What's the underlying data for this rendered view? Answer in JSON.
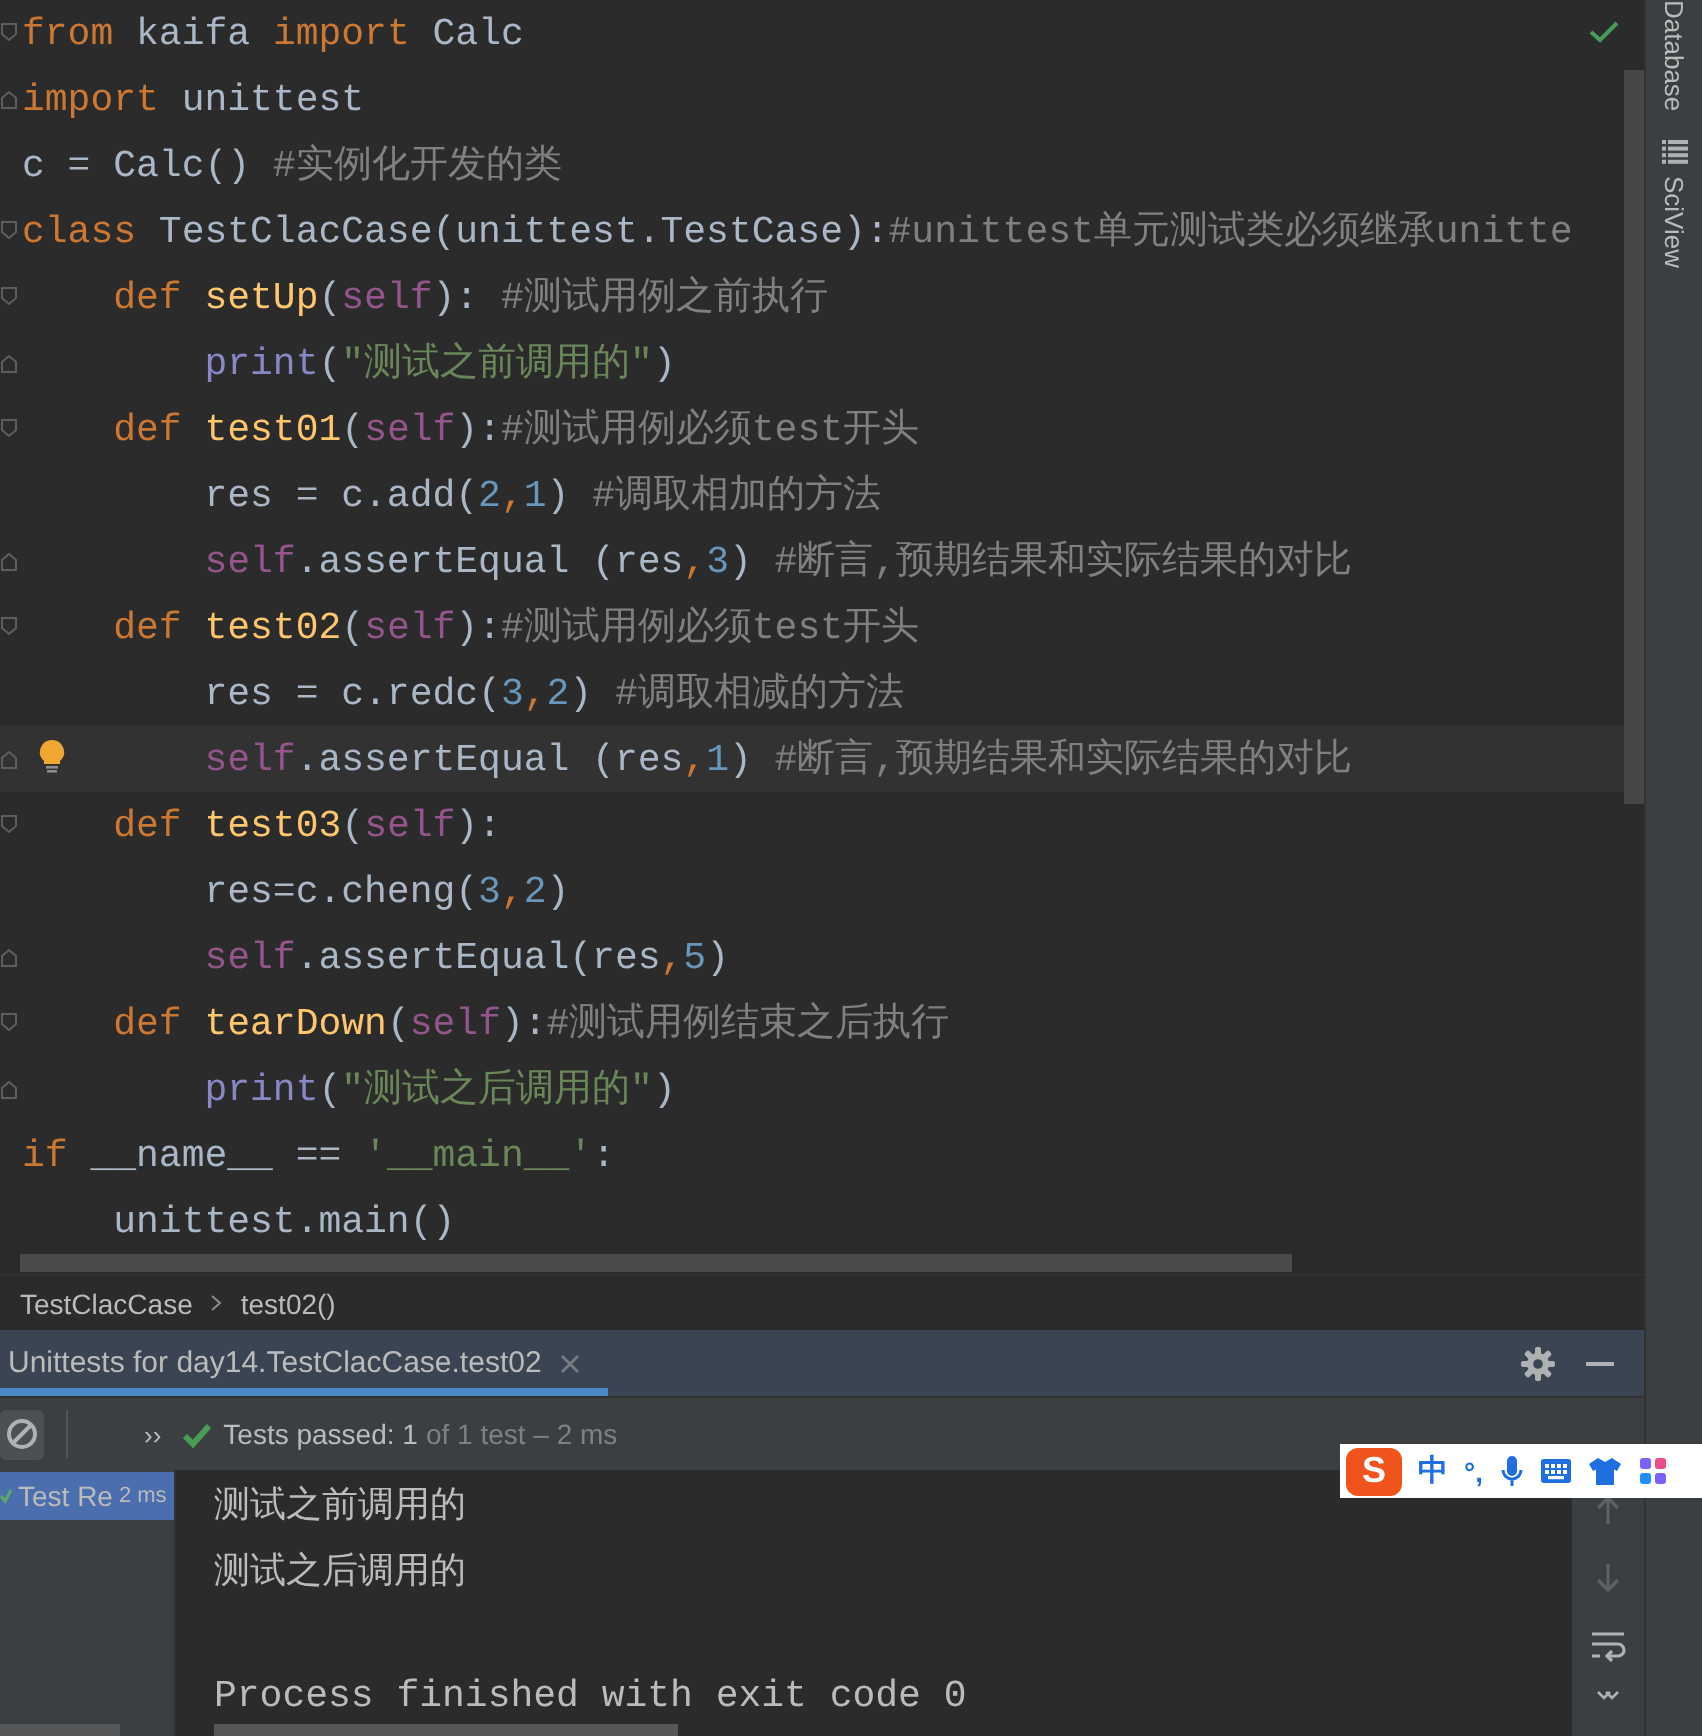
{
  "editor": {
    "inspection_ok": true,
    "lines": [
      {
        "current": false,
        "bulb": false,
        "fold_start": true,
        "fold_end": false,
        "tokens": [
          {
            "kind": "keyword",
            "text": "from"
          },
          {
            "kind": "plain",
            "text": " kaifa "
          },
          {
            "kind": "keyword",
            "text": "import"
          },
          {
            "kind": "plain",
            "text": " Calc"
          }
        ]
      },
      {
        "current": false,
        "bulb": false,
        "fold_start": false,
        "fold_end": true,
        "tokens": [
          {
            "kind": "keyword",
            "text": "import"
          },
          {
            "kind": "plain",
            "text": " unittest"
          }
        ]
      },
      {
        "current": false,
        "bulb": false,
        "fold_start": false,
        "fold_end": false,
        "tokens": [
          {
            "kind": "plain",
            "text": "c = Calc() "
          },
          {
            "kind": "comment",
            "text": "#实例化开发的类"
          }
        ]
      },
      {
        "current": false,
        "bulb": false,
        "fold_start": true,
        "fold_end": false,
        "tokens": [
          {
            "kind": "keyword",
            "text": "class"
          },
          {
            "kind": "plain",
            "text": " TestClacCase(unittest.TestCase):"
          },
          {
            "kind": "comment",
            "text": "#unittest单元测试类必须继承unitte"
          }
        ]
      },
      {
        "current": false,
        "bulb": false,
        "fold_start": true,
        "fold_end": false,
        "tokens": [
          {
            "kind": "keyword",
            "text": "    def"
          },
          {
            "kind": "function",
            "text": " setUp"
          },
          {
            "kind": "plain",
            "text": "("
          },
          {
            "kind": "self",
            "text": "self"
          },
          {
            "kind": "plain",
            "text": "): "
          },
          {
            "kind": "comment",
            "text": "#测试用例之前执行"
          }
        ]
      },
      {
        "current": false,
        "bulb": false,
        "fold_start": false,
        "fold_end": true,
        "tokens": [
          {
            "kind": "builtin",
            "text": "        print"
          },
          {
            "kind": "plain",
            "text": "("
          },
          {
            "kind": "string",
            "text": "\"测试之前调用的\""
          },
          {
            "kind": "plain",
            "text": ")"
          }
        ]
      },
      {
        "current": false,
        "bulb": false,
        "fold_start": true,
        "fold_end": false,
        "tokens": [
          {
            "kind": "keyword",
            "text": "    def"
          },
          {
            "kind": "function",
            "text": " test01"
          },
          {
            "kind": "plain",
            "text": "("
          },
          {
            "kind": "self",
            "text": "self"
          },
          {
            "kind": "plain",
            "text": "):"
          },
          {
            "kind": "comment",
            "text": "#测试用例必须test开头"
          }
        ]
      },
      {
        "current": false,
        "bulb": false,
        "fold_start": false,
        "fold_end": false,
        "tokens": [
          {
            "kind": "plain",
            "text": "        res = c.add("
          },
          {
            "kind": "number",
            "text": "2"
          },
          {
            "kind": "punct",
            "text": ","
          },
          {
            "kind": "number",
            "text": "1"
          },
          {
            "kind": "plain",
            "text": ") "
          },
          {
            "kind": "comment",
            "text": "#调取相加的方法"
          }
        ]
      },
      {
        "current": false,
        "bulb": false,
        "fold_start": false,
        "fold_end": true,
        "tokens": [
          {
            "kind": "self",
            "text": "        self"
          },
          {
            "kind": "plain",
            "text": ".assertEqual (res"
          },
          {
            "kind": "punct",
            "text": ","
          },
          {
            "kind": "number",
            "text": "3"
          },
          {
            "kind": "plain",
            "text": ") "
          },
          {
            "kind": "comment",
            "text": "#断言,预期结果和实际结果的对比"
          }
        ]
      },
      {
        "current": false,
        "bulb": false,
        "fold_start": true,
        "fold_end": false,
        "tokens": [
          {
            "kind": "keyword",
            "text": "    def"
          },
          {
            "kind": "function",
            "text": " test02"
          },
          {
            "kind": "plain",
            "text": "("
          },
          {
            "kind": "self",
            "text": "self"
          },
          {
            "kind": "plain",
            "text": "):"
          },
          {
            "kind": "comment",
            "text": "#测试用例必须test开头"
          }
        ]
      },
      {
        "current": false,
        "bulb": false,
        "fold_start": false,
        "fold_end": false,
        "tokens": [
          {
            "kind": "plain",
            "text": "        res = c.redc("
          },
          {
            "kind": "number",
            "text": "3"
          },
          {
            "kind": "punct",
            "text": ","
          },
          {
            "kind": "number",
            "text": "2"
          },
          {
            "kind": "plain",
            "text": ") "
          },
          {
            "kind": "comment",
            "text": "#调取相减的方法"
          }
        ]
      },
      {
        "current": true,
        "bulb": true,
        "fold_start": false,
        "fold_end": true,
        "tokens": [
          {
            "kind": "self",
            "text": "        self"
          },
          {
            "kind": "plain",
            "text": ".assertEqual (res"
          },
          {
            "kind": "punct",
            "text": ","
          },
          {
            "kind": "number",
            "text": "1"
          },
          {
            "kind": "plain",
            "text": ") "
          },
          {
            "kind": "comment",
            "text": "#断言,预期结果和实际结果的对比"
          }
        ]
      },
      {
        "current": false,
        "bulb": false,
        "fold_start": true,
        "fold_end": false,
        "tokens": [
          {
            "kind": "keyword",
            "text": "    def"
          },
          {
            "kind": "function",
            "text": " test03"
          },
          {
            "kind": "plain",
            "text": "("
          },
          {
            "kind": "self",
            "text": "self"
          },
          {
            "kind": "plain",
            "text": "):"
          }
        ]
      },
      {
        "current": false,
        "bulb": false,
        "fold_start": false,
        "fold_end": false,
        "tokens": [
          {
            "kind": "plain",
            "text": "        res=c.cheng("
          },
          {
            "kind": "number",
            "text": "3"
          },
          {
            "kind": "punct",
            "text": ","
          },
          {
            "kind": "number",
            "text": "2"
          },
          {
            "kind": "plain",
            "text": ")"
          }
        ]
      },
      {
        "current": false,
        "bulb": false,
        "fold_start": false,
        "fold_end": true,
        "tokens": [
          {
            "kind": "self",
            "text": "        self"
          },
          {
            "kind": "plain",
            "text": ".assertEqual(res"
          },
          {
            "kind": "punct",
            "text": ","
          },
          {
            "kind": "number",
            "text": "5"
          },
          {
            "kind": "plain",
            "text": ")"
          }
        ]
      },
      {
        "current": false,
        "bulb": false,
        "fold_start": true,
        "fold_end": false,
        "tokens": [
          {
            "kind": "keyword",
            "text": "    def"
          },
          {
            "kind": "function",
            "text": " tearDown"
          },
          {
            "kind": "plain",
            "text": "("
          },
          {
            "kind": "self",
            "text": "self"
          },
          {
            "kind": "plain",
            "text": "):"
          },
          {
            "kind": "comment",
            "text": "#测试用例结束之后执行"
          }
        ]
      },
      {
        "current": false,
        "bulb": false,
        "fold_start": false,
        "fold_end": true,
        "tokens": [
          {
            "kind": "builtin",
            "text": "        print"
          },
          {
            "kind": "plain",
            "text": "("
          },
          {
            "kind": "string",
            "text": "\"测试之后调用的\""
          },
          {
            "kind": "plain",
            "text": ")"
          }
        ]
      },
      {
        "current": false,
        "bulb": false,
        "fold_start": false,
        "fold_end": false,
        "tokens": [
          {
            "kind": "keyword",
            "text": "if"
          },
          {
            "kind": "plain",
            "text": " __name__ == "
          },
          {
            "kind": "string",
            "text": "'__main__'"
          },
          {
            "kind": "plain",
            "text": ":"
          }
        ]
      },
      {
        "current": false,
        "bulb": false,
        "fold_start": false,
        "fold_end": false,
        "tokens": [
          {
            "kind": "plain",
            "text": "    unittest.main()"
          }
        ]
      }
    ]
  },
  "tool_strip": [
    {
      "kind": "text",
      "label": "Database"
    },
    {
      "kind": "with_icon",
      "label": "SciView"
    }
  ],
  "breadcrumb": [
    "TestClacCase",
    "test02()"
  ],
  "run_panel": {
    "tab": {
      "label": "Unittests for day14.TestClacCase.test02",
      "selected": true
    },
    "more": "››",
    "status": {
      "passed": true,
      "summary": "Tests passed: 1",
      "detail": "of 1 test – 2 ms"
    },
    "tree": [
      {
        "label": "Test Re",
        "time": "2 ms",
        "selected": true,
        "passed": true
      }
    ],
    "console": [
      {
        "kind": "stdout",
        "text": "测试之前调用的"
      },
      {
        "kind": "stdout",
        "text": "测试之后调用的"
      },
      {
        "kind": "blank"
      },
      {
        "kind": "system",
        "text": "Process finished with exit code 0"
      }
    ]
  },
  "ime_toolbar": {
    "logo": "S",
    "mode": "中",
    "punctuation": "°,"
  }
}
